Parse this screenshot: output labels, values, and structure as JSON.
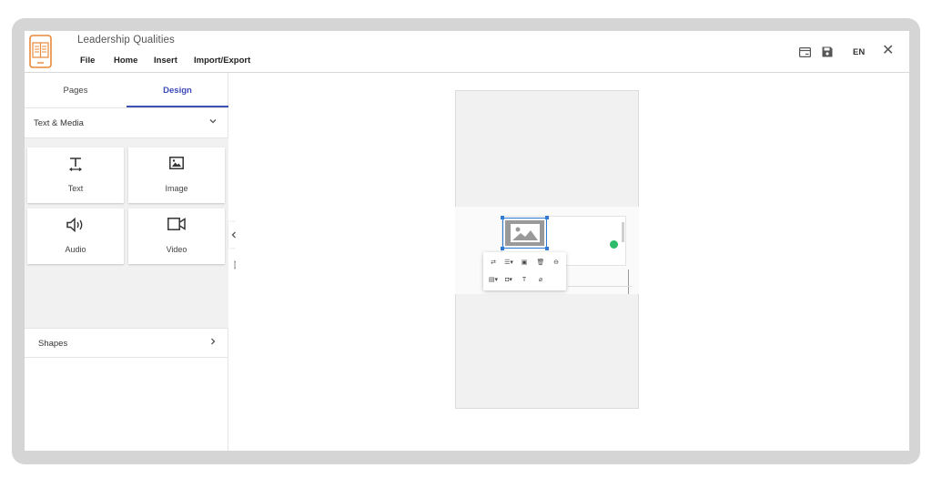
{
  "app": {
    "document_title": "Leadership Qualities",
    "menu": [
      "File",
      "Home",
      "Insert",
      "Import/Export"
    ],
    "language": "EN"
  },
  "panel": {
    "tabs": [
      {
        "label": "Pages",
        "active": false
      },
      {
        "label": "Design",
        "active": true
      }
    ],
    "text_media_section": "Text & Media",
    "tiles": [
      {
        "label": "Text",
        "icon": "text-icon"
      },
      {
        "label": "Image",
        "icon": "image-icon"
      },
      {
        "label": "Audio",
        "icon": "audio-icon"
      },
      {
        "label": "Video",
        "icon": "video-icon"
      }
    ],
    "shapes_section": "Shapes"
  },
  "toolbar": {
    "text_tool": "T"
  },
  "colors": {
    "accent": "#3f51b5",
    "logo": "#e8883a",
    "selection": "#2f7cd6",
    "status_dot": "#2dbb6a"
  }
}
